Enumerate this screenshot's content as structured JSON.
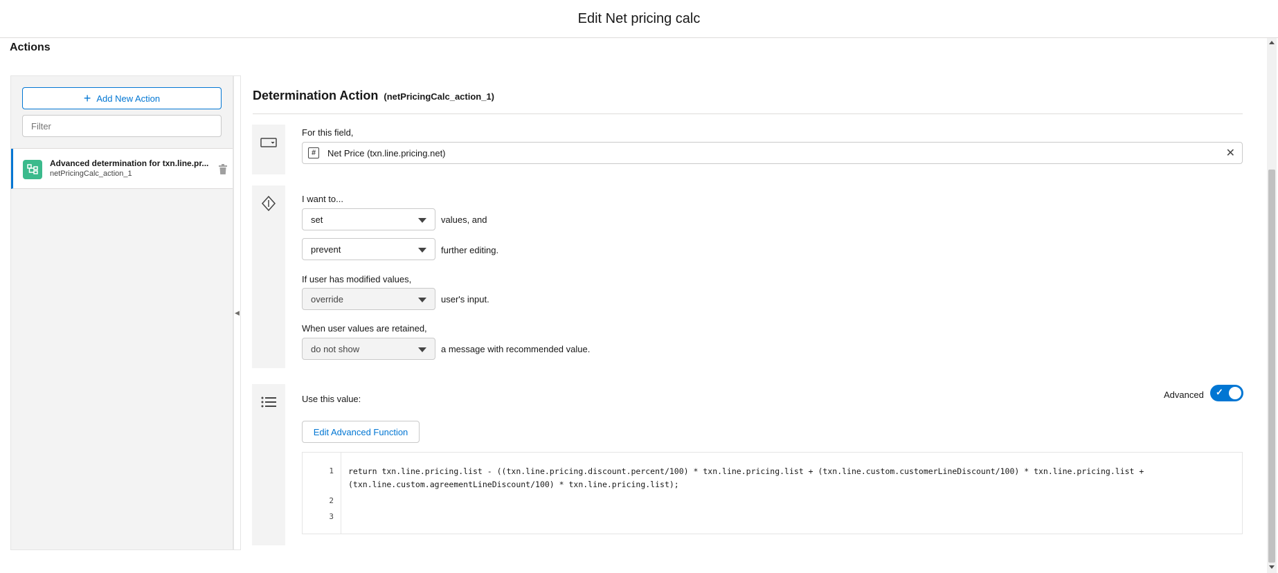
{
  "header": {
    "title": "Edit Net pricing calc"
  },
  "section": {
    "title": "Actions"
  },
  "sidebar": {
    "add_button_label": "Add New Action",
    "filter_placeholder": "Filter",
    "items": [
      {
        "title": "Advanced determination for txn.line.pr...",
        "subtitle": "netPricingCalc_action_1",
        "icon": "flow-icon",
        "selected": true
      }
    ]
  },
  "main": {
    "title": "Determination Action",
    "api_name": "(netPricingCalc_action_1)",
    "field_section": {
      "label": "For this field,",
      "field_icon": "hash-icon",
      "field_value": "Net Price (txn.line.pricing.net)"
    },
    "behavior_section": {
      "label": "I want to...",
      "action_select": "set",
      "action_suffix": "values, and",
      "edit_select": "prevent",
      "edit_suffix": "further editing.",
      "modified_label": "If user has modified values,",
      "override_select": "override",
      "override_suffix": "user's input.",
      "retained_label": "When user values are retained,",
      "message_select": "do not show",
      "message_suffix": "a message with recommended value."
    },
    "value_section": {
      "label": "Use this value:",
      "toggle_label": "Advanced",
      "toggle_on": true,
      "edit_button_label": "Edit Advanced Function",
      "line_numbers": [
        "1",
        "2",
        "3"
      ],
      "code_line_1": "return txn.line.pricing.list - ((txn.line.pricing.discount.percent/100) * txn.line.pricing.list + (txn.line.custom.customerLineDiscount/100) * txn.line.pricing.list + (txn.line.custom.agreementLineDiscount/100) * txn.line.pricing.list);"
    }
  },
  "colors": {
    "brand": "#0176d3",
    "action_icon_bg": "#3bba8c",
    "rail_bg": "#f3f3f3"
  }
}
